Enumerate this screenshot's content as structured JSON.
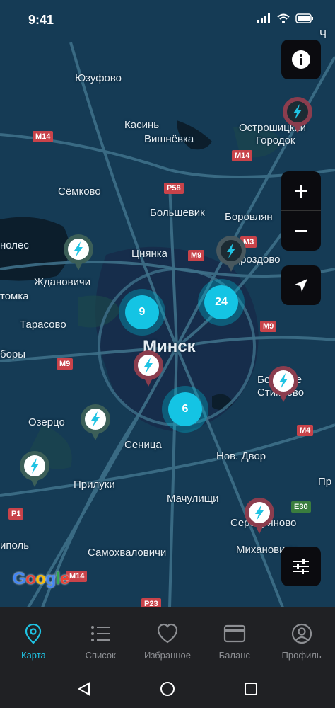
{
  "status_bar": {
    "time": "9:41"
  },
  "map": {
    "labels": {
      "yuzufovo": "Юзуфово",
      "ostroshitsky": "Острошицкий",
      "gorodok": "Городок",
      "kasin": "Касинь",
      "vishnevka": "Вишнёвка",
      "semkovo": "Сёмково",
      "bolshevik": "Большевик",
      "borovlyany": "Боровлян",
      "nolesie": "нолес",
      "tsnyanka": "Цнянка",
      "zhdanovichi": "Ждановичи",
      "drozdovo": "Дроздово",
      "tomka": "томка",
      "tarasovo": "Тарасово",
      "minsk": "Минск",
      "bory": "боры",
      "ozertso": "Озерцо",
      "senitsa": "Сеница",
      "novy_dvor": "Нов. Двор",
      "priluki": "Прилуки",
      "machulishchi": "Мачулищи",
      "bolshoe_stiklevo": "Большое Стиклево",
      "serebryanovo": "Серебряново",
      "ipol": "иполь",
      "samokhvalovichi": "Самохваловичи",
      "mikhanovichi": "Михановичи",
      "ch": "Ч",
      "p": "Пр"
    },
    "road_signs": {
      "m14_a": "M14",
      "m14_b": "M14",
      "m14_c": "M14",
      "p58": "P58",
      "m9_a": "M9",
      "m3": "M3",
      "m9_b": "M9",
      "m9_c": "M9",
      "m4": "M4",
      "p1": "P1",
      "e30": "E30",
      "p23": "P23"
    },
    "clusters": [
      {
        "count": "9"
      },
      {
        "count": "24"
      },
      {
        "count": "6"
      }
    ],
    "attribution": "Google"
  },
  "tabs": [
    {
      "label": "Карта",
      "icon": "location-pin-icon",
      "active": true
    },
    {
      "label": "Список",
      "icon": "list-icon",
      "active": false
    },
    {
      "label": "Избранное",
      "icon": "heart-icon",
      "active": false
    },
    {
      "label": "Баланс",
      "icon": "credit-card-icon",
      "active": false
    },
    {
      "label": "Профиль",
      "icon": "user-profile-icon",
      "active": false
    }
  ],
  "colors": {
    "map_background": "#153b55",
    "accent": "#1fc3e3",
    "pin_red": "#8b3d4e",
    "pin_dark": "#2a3a40"
  }
}
